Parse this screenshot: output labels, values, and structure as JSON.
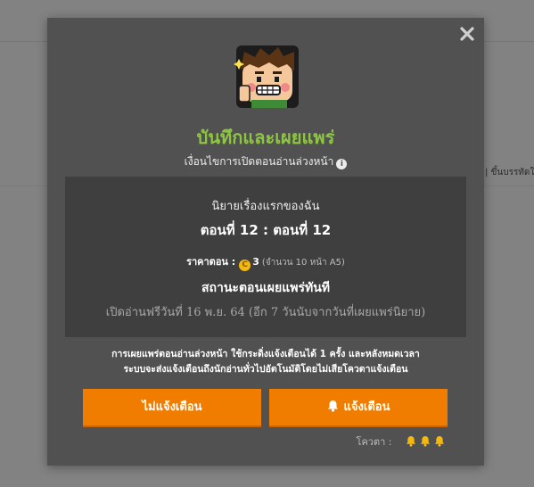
{
  "background": {
    "side_text": "| ขึ้นบรรทัดใ"
  },
  "modal": {
    "title": "บันทึกและเผยแพร่",
    "subtitle": "เงื่อนไขการเปิดตอนอ่านล่วงหน้า",
    "info_icon": "info-icon",
    "close_icon": "close-icon",
    "novel_title": "นิยายเรื่องแรกของฉัน",
    "episode": "ตอนที่ 12 : ตอนที่ 12",
    "price_label": "ราคาตอน :",
    "price_value": "3",
    "price_note": "(จำนวน 10 หน้า A5)",
    "status": "สถานะตอนเผยแพร่ทันที",
    "free_date": "เปิดอ่านฟรีวันที่ 16 พ.ย. 64 (อีก 7 วันนับจากวันที่เผยแพร่นิยาย)",
    "description_line1": "การเผยแพร่ตอนอ่านล่วงหน้า ใช้กระดิ่งแจ้งเตือนได้ 1 ครั้ง และหลังหมดเวลา",
    "description_line2": "ระบบจะส่งแจ้งเตือนถึงนักอ่านทั่วไปอัตโนมัติโดยไม่เสียโควตาแจ้งเตือน",
    "btn_no_notify": "ไม่แจ้งเตือน",
    "btn_notify": "แจ้งเตือน",
    "quota_label": "โควตา :",
    "quota_bells": 3,
    "colors": {
      "accent_green": "#8dc63f",
      "button_orange": "#f07d00",
      "bell_yellow": "#f4b90f"
    }
  }
}
